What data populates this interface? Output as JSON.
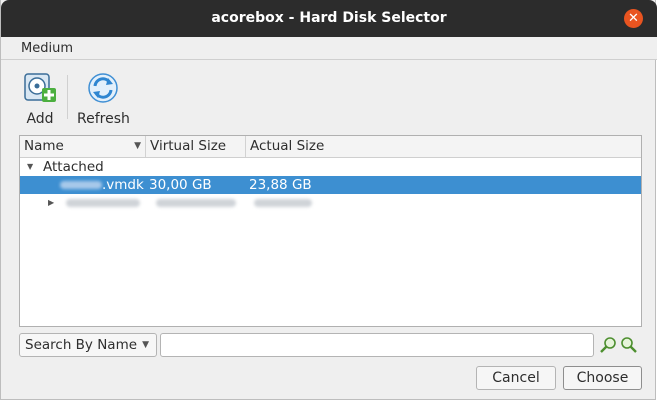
{
  "window": {
    "title": "acorebox - Hard Disk Selector",
    "close_glyph": "✕"
  },
  "menubar": {
    "items": [
      {
        "label": "Medium"
      }
    ]
  },
  "toolbar": {
    "add": {
      "label": "Add",
      "icon": "add-disk-icon"
    },
    "refresh": {
      "label": "Refresh",
      "icon": "refresh-icon"
    }
  },
  "tree": {
    "columns": [
      {
        "label": "Name"
      },
      {
        "label": "Virtual Size"
      },
      {
        "label": "Actual Size"
      }
    ],
    "group": {
      "label": "Attached"
    },
    "rows": [
      {
        "name_suffix": ".vmdk",
        "virtual_size": "30,00 GB",
        "actual_size": "23,88 GB",
        "selected": true
      },
      {
        "name_suffix": "",
        "virtual_size": "",
        "actual_size": "",
        "selected": false,
        "collapsed": true
      }
    ]
  },
  "search": {
    "mode": "Search By Name",
    "value": "",
    "next_icon": "find-next-icon",
    "prev_icon": "find-previous-icon"
  },
  "buttons": {
    "cancel": "Cancel",
    "choose": "Choose"
  },
  "colors": {
    "titlebar": "#2c2c2c",
    "close": "#e95420",
    "selection": "#3d8fd1",
    "dialog_bg": "#efefef"
  }
}
